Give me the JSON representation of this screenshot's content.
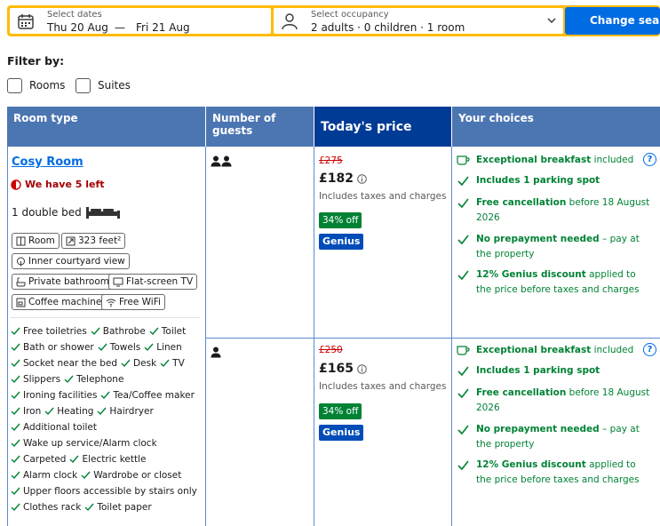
{
  "search": {
    "dates_label": "Select dates",
    "date_from": "Thu 20 Aug",
    "date_sep": "—",
    "date_to": "Fri 21 Aug",
    "occupancy_label": "Select occupancy",
    "occupancy_value": "2 adults · 0 children · 1 room",
    "button": "Change search"
  },
  "filter": {
    "title": "Filter by:",
    "options": [
      "Rooms",
      "Suites"
    ]
  },
  "table": {
    "headers": [
      "Room type",
      "Number of guests",
      "Today's price",
      "Your choices"
    ]
  },
  "room": {
    "name": "Cosy Room",
    "availability": "We have 5 left",
    "bed": "1 double bed",
    "chips": [
      {
        "icon": "room-icon",
        "label": "Room"
      },
      {
        "icon": "size-icon",
        "label": "323 feet²"
      },
      {
        "icon": "view-icon",
        "label": "Inner courtyard view"
      },
      {
        "icon": "bath-icon",
        "label": "Private bathroom"
      },
      {
        "icon": "tv-icon",
        "label": "Flat-screen TV"
      },
      {
        "icon": "coffee-icon",
        "label": "Coffee machine"
      },
      {
        "icon": "wifi-icon",
        "label": "Free WiFi"
      }
    ],
    "amenities": [
      [
        "Free toiletries",
        "Bathrobe",
        "Toilet"
      ],
      [
        "Bath or shower",
        "Towels",
        "Linen"
      ],
      [
        "Socket near the bed",
        "Desk",
        "TV"
      ],
      [
        "Slippers",
        "Telephone"
      ],
      [
        "Ironing facilities",
        "Tea/Coffee maker"
      ],
      [
        "Iron",
        "Heating",
        "Hairdryer"
      ],
      [
        "Additional toilet"
      ],
      [
        "Wake up service/Alarm clock"
      ],
      [
        "Carpeted",
        "Electric kettle"
      ],
      [
        "Alarm clock",
        "Wardrobe or closet"
      ],
      [
        "Upper floors accessible by stairs only"
      ],
      [
        "Clothes rack",
        "Toilet paper"
      ]
    ]
  },
  "options": [
    {
      "guests": 2,
      "old_price": "£275",
      "price": "£182",
      "taxes": "Includes taxes and charges",
      "discount": "34% off",
      "genius": "Genius",
      "choices": {
        "breakfast_b": "Exceptional breakfast",
        "breakfast_t": " included",
        "parking_b": "Includes 1 parking spot",
        "cancel_b": "Free cancellation",
        "cancel_t": " before 18 August 2026",
        "prepay_b": "No prepayment needed",
        "prepay_t": " – pay at the property",
        "genius_b": "12% Genius discount",
        "genius_t": " applied to the price before taxes and charges"
      }
    },
    {
      "guests": 1,
      "old_price": "£250",
      "price": "£165",
      "taxes": "Includes taxes and charges",
      "discount": "34% off",
      "genius": "Genius",
      "choices": {
        "breakfast_b": "Exceptional breakfast",
        "breakfast_t": " included",
        "parking_b": "Includes 1 parking spot",
        "cancel_b": "Free cancellation",
        "cancel_t": " before 18 August 2026",
        "prepay_b": "No prepayment needed",
        "prepay_t": " – pay at the property",
        "genius_b": "12% Genius discount",
        "genius_t": " applied to the price before taxes and charges"
      }
    }
  ],
  "colors": {
    "brand_yellow": "#febb02",
    "brand_blue": "#006ce4",
    "header_blue": "#4c76b2",
    "header_dark": "#003b95",
    "green": "#008234",
    "alert_red": "#c00"
  }
}
